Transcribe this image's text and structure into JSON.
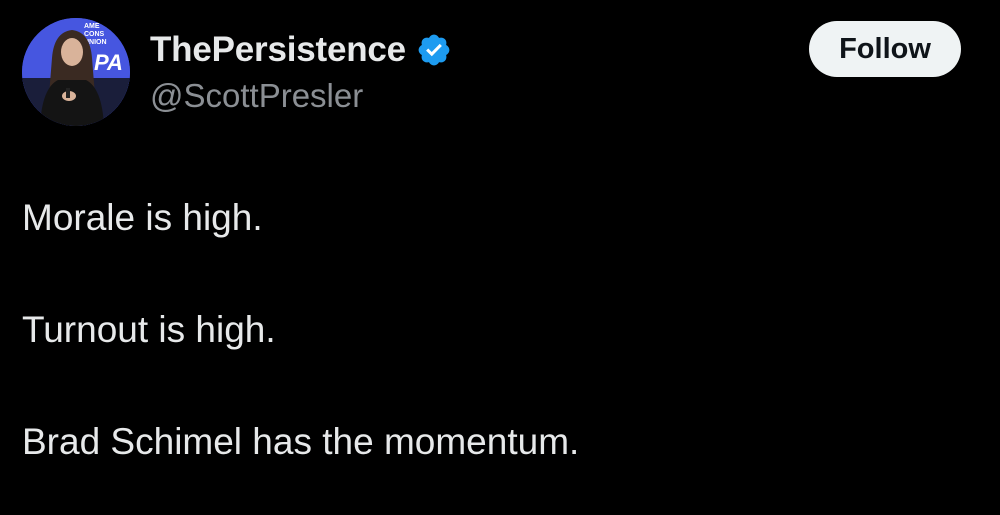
{
  "tweet": {
    "author": {
      "display_name": "ThePersistence",
      "handle": "@ScottPresler",
      "verified": true,
      "avatar_sign_text": [
        "AME",
        "CONS",
        "UNION",
        "PA"
      ]
    },
    "follow_button_label": "Follow",
    "lines": [
      "Morale is high.",
      "Turnout is high.",
      "Brad Schimel has the momentum."
    ]
  },
  "colors": {
    "background": "#000000",
    "text_primary": "#e7e9ea",
    "text_secondary": "#8b8f94",
    "verified_blue": "#1d9bf0",
    "button_bg": "#eff3f4",
    "button_text": "#0f1419"
  },
  "icons": {
    "verified": "verified-badge-icon"
  }
}
